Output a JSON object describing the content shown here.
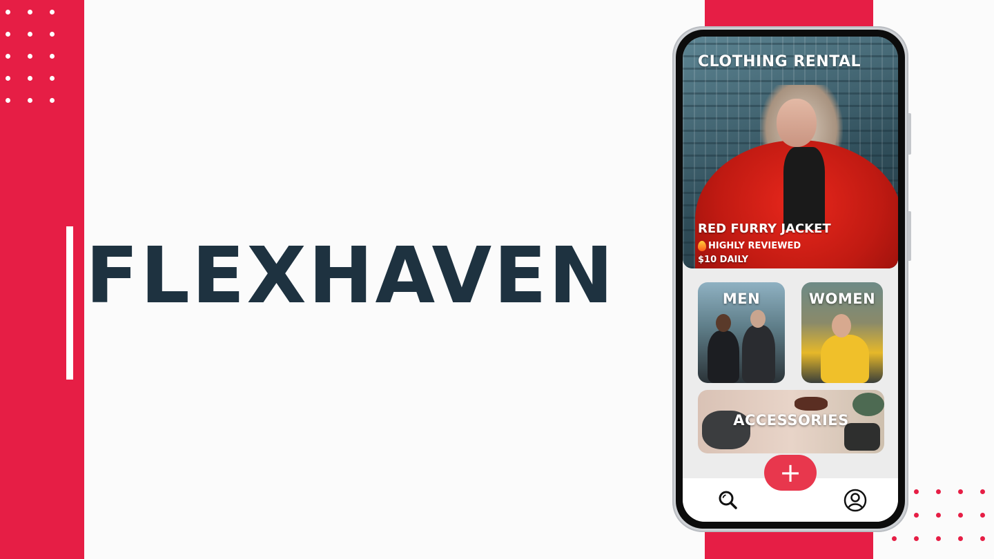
{
  "brand": {
    "name": "FLEXHAVEN"
  },
  "app": {
    "header_title": "CLOTHING RENTAL",
    "featured": {
      "product_name": "RED FURRY JACKET",
      "badge": "HIGHLY REVIEWED",
      "price": "$10 DAILY"
    },
    "categories": [
      {
        "label": "MEN"
      },
      {
        "label": "WOMEN"
      },
      {
        "label": "ACCESSORIES"
      }
    ],
    "fab_label": "+",
    "nav": [
      {
        "icon": "search-icon"
      },
      {
        "icon": "profile-icon"
      }
    ]
  },
  "colors": {
    "accent": "#e61e45",
    "title_text": "#1e3240",
    "fab": "#e8374d"
  }
}
